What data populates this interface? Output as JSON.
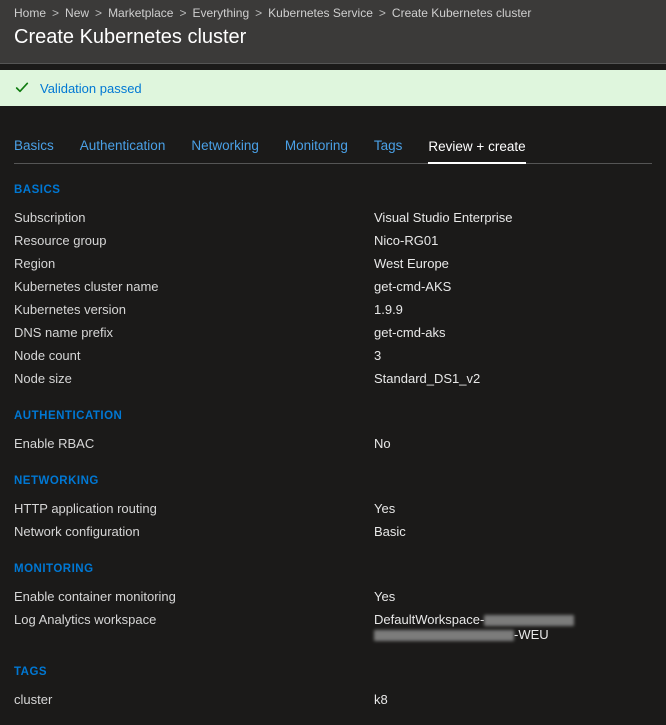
{
  "breadcrumb": {
    "items": [
      {
        "label": "Home"
      },
      {
        "label": "New"
      },
      {
        "label": "Marketplace"
      },
      {
        "label": "Everything"
      },
      {
        "label": "Kubernetes Service"
      },
      {
        "label": "Create Kubernetes cluster"
      }
    ],
    "separator": ">"
  },
  "page_title": "Create Kubernetes cluster",
  "validation": {
    "message": "Validation passed"
  },
  "tabs": [
    {
      "label": "Basics",
      "active": false
    },
    {
      "label": "Authentication",
      "active": false
    },
    {
      "label": "Networking",
      "active": false
    },
    {
      "label": "Monitoring",
      "active": false
    },
    {
      "label": "Tags",
      "active": false
    },
    {
      "label": "Review + create",
      "active": true
    }
  ],
  "sections": {
    "basics": {
      "heading": "BASICS",
      "rows": [
        {
          "k": "Subscription",
          "v": "Visual Studio Enterprise"
        },
        {
          "k": "Resource group",
          "v": "Nico-RG01"
        },
        {
          "k": "Region",
          "v": "West Europe"
        },
        {
          "k": "Kubernetes cluster name",
          "v": "get-cmd-AKS"
        },
        {
          "k": "Kubernetes version",
          "v": "1.9.9"
        },
        {
          "k": "DNS name prefix",
          "v": "get-cmd-aks"
        },
        {
          "k": "Node count",
          "v": "3"
        },
        {
          "k": "Node size",
          "v": "Standard_DS1_v2"
        }
      ]
    },
    "authentication": {
      "heading": "AUTHENTICATION",
      "rows": [
        {
          "k": "Enable RBAC",
          "v": "No"
        }
      ]
    },
    "networking": {
      "heading": "NETWORKING",
      "rows": [
        {
          "k": "HTTP application routing",
          "v": "Yes"
        },
        {
          "k": "Network configuration",
          "v": "Basic"
        }
      ]
    },
    "monitoring": {
      "heading": "MONITORING",
      "rows": [
        {
          "k": "Enable container monitoring",
          "v": "Yes"
        },
        {
          "k": "Log Analytics workspace",
          "v": "DefaultWorkspace-",
          "redacted_suffix": "-WEU"
        }
      ]
    },
    "tags": {
      "heading": "TAGS",
      "rows": [
        {
          "k": "cluster",
          "v": "k8"
        }
      ]
    }
  }
}
